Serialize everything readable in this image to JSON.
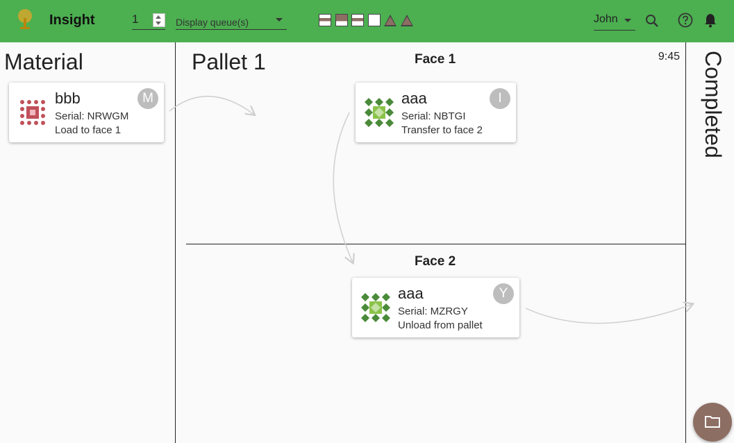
{
  "header": {
    "title": "Insight",
    "number_value": "1",
    "queue_placeholder": "Display queue(s)",
    "user": "John",
    "legend_icons": [
      "stripe-square",
      "brown-white-square",
      "stripe-square",
      "white-square",
      "brown-triangle",
      "brown-triangle"
    ]
  },
  "material": {
    "title": "Material"
  },
  "pallet": {
    "title": "Pallet 1",
    "clock": "9:45",
    "face1_title": "Face 1",
    "face2_title": "Face 2"
  },
  "completed": {
    "title": "Completed"
  },
  "cards": {
    "material_card": {
      "part": "bbb",
      "serial": "Serial: NRWGM",
      "action": "Load to face 1",
      "avatar": "M"
    },
    "face1_card": {
      "part": "aaa",
      "serial": "Serial: NBTGI",
      "action": "Transfer to face 2",
      "avatar": "I"
    },
    "face2_card": {
      "part": "aaa",
      "serial": "Serial: MZRGY",
      "action": "Unload from pallet",
      "avatar": "Y"
    }
  },
  "colors": {
    "appbar": "#4caf50",
    "fab": "#8d6e63",
    "legend_brown": "#8d6e63",
    "bbb_icon": "#c0505a",
    "aaa_icon": "#4a8a3a"
  }
}
